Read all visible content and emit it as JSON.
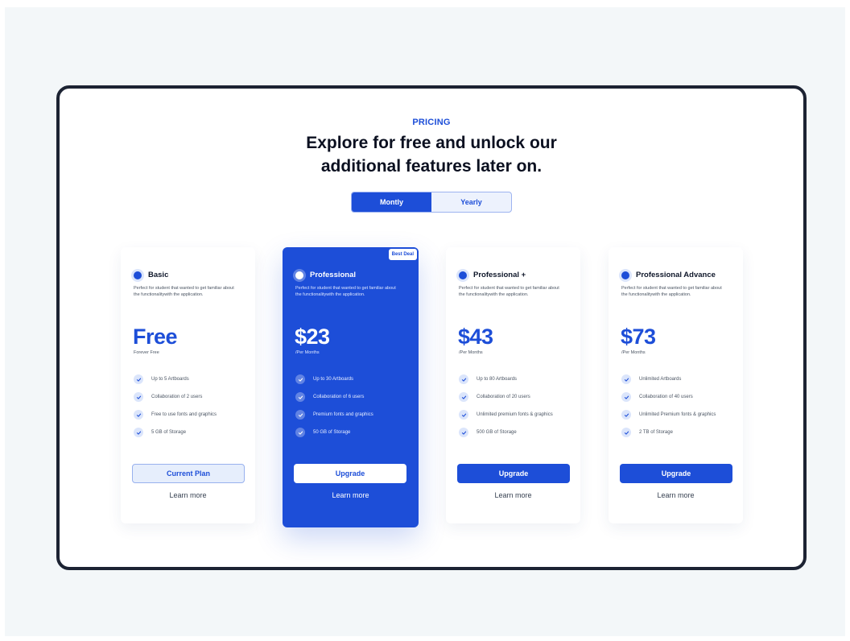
{
  "header": {
    "eyebrow": "PRICING",
    "headline_line1": "Explore for free and unlock our",
    "headline_line2": "additional features later on."
  },
  "billing_toggle": {
    "monthly_label": "Montly",
    "yearly_label": "Yearly",
    "selected": "Montly"
  },
  "colors": {
    "accent": "#1d4ed8",
    "frame": "#1c2333",
    "background": "#f3f7f9"
  },
  "plans": [
    {
      "name": "Basic",
      "description": "Perfect for student that wanted to get familiar about the functionalitywith the application.",
      "price": "Free",
      "period": "Forever Free",
      "features": [
        "Up to 5 Artboards",
        "Collaboration of 2 users",
        "Free to use fonts and graphics",
        "5 GB of Storage"
      ],
      "button_label": "Current Plan",
      "learn_more": "Learn more"
    },
    {
      "name": "Professional",
      "badge": "Best Deal",
      "description": "Perfect for student that wanted to get familiar about the functionalitywith the application.",
      "price": "$23",
      "period": "/Per Months",
      "features": [
        "Up to 30 Artboards",
        "Collaboration of 6 users",
        "Premium fonts and graphics",
        "50 GB of Storage"
      ],
      "button_label": "Upgrade",
      "learn_more": "Learn more"
    },
    {
      "name": "Professional +",
      "description": "Perfect for student that wanted to get familiar about the functionalitywith the application.",
      "price": "$43",
      "period": "/Per Months",
      "features": [
        "Up to 80 Artboards",
        "Collaboration of 20 users",
        "Unlimited premium fonts & graphics",
        "500 GB of Storage"
      ],
      "button_label": "Upgrade",
      "learn_more": "Learn more"
    },
    {
      "name": "Professional Advance",
      "description": "Perfect for student that wanted to get familiar about the functionalitywith the application.",
      "price": "$73",
      "period": "/Per Months",
      "features": [
        "Unlimited Artboards",
        "Collaboration of 40 users",
        "Unlimited Premium fonts & graphics",
        "2 TB of Storage"
      ],
      "button_label": "Upgrade",
      "learn_more": "Learn more"
    }
  ]
}
